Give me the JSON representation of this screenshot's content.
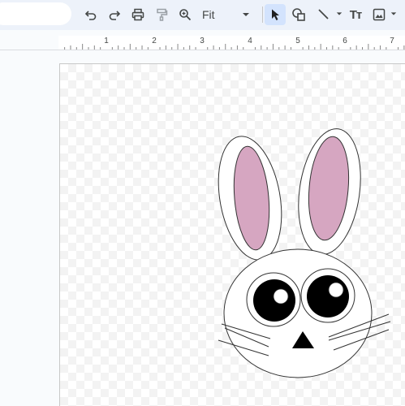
{
  "toolbar": {
    "zoom_value": "Fit",
    "buttons": [
      {
        "name": "undo-icon"
      },
      {
        "name": "redo-icon"
      },
      {
        "name": "print-icon"
      },
      {
        "name": "paint-format-icon"
      },
      {
        "name": "zoom-icon"
      },
      {
        "name": "select-cursor-icon"
      },
      {
        "name": "shape-icon"
      },
      {
        "name": "line-icon"
      },
      {
        "name": "text-box-icon"
      },
      {
        "name": "image-icon"
      }
    ],
    "text_box_glyph": "Tт",
    "active_tool": "select"
  },
  "ruler": {
    "numbers": [
      "1",
      "2",
      "3",
      "4",
      "5",
      "6",
      "7"
    ]
  },
  "drawing": {
    "subject": "bunny-face",
    "colors": {
      "ear_inner": "#d6a6c1",
      "eye": "#000000",
      "nose": "#000000",
      "outline": "#333333",
      "fill": "#ffffff"
    }
  }
}
